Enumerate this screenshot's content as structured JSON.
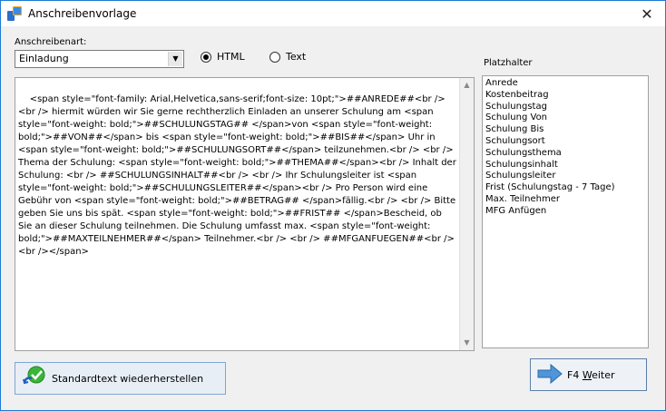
{
  "window": {
    "title": "Anschreibenvorlage"
  },
  "form": {
    "type_label": "Anschreibenart:",
    "type_selected": "Einladung",
    "radio_html_label": "HTML",
    "radio_text_label": "Text",
    "format_selected": "HTML",
    "template_text": "<span style=\"font-family: Arial,Helvetica,sans-serif;font-size: 10pt;\">##ANREDE##<br />\n<br /> hiermit würden wir Sie gerne rechtherzlich Einladen an unserer Schulung am <span style=\"font-weight: bold;\">##SCHULUNGSTAG## </span>von <span style=\"font-weight: bold;\">##VON##</span> bis <span style=\"font-weight: bold;\">##BIS##</span> Uhr in <span style=\"font-weight: bold;\">##SCHULUNGSORT##</span> teilzunehmen.<br /> <br /> Thema der Schulung: <span style=\"font-weight: bold;\">##THEMA##</span><br /> Inhalt der Schulung: <br /> ##SCHULUNGSINHALT##<br /> <br /> Ihr Schulungsleiter ist <span style=\"font-weight: bold;\">##SCHULUNGSLEITER##</span><br /> Pro Person wird eine Gebühr von <span style=\"font-weight: bold;\">##BETRAG## </span>fällig.<br /> <br /> Bitte geben Sie uns bis spät. <span style=\"font-weight: bold;\">##FRIST## </span>Bescheid, ob Sie an dieser Schulung teilnehmen. Die Schulung umfasst max. <span style=\"font-weight: bold;\">##MAXTEILNEHMER##</span> Teilnehmer.<br /> <br /> ##MFGANFUEGEN##<br /> <br /></span>"
  },
  "placeholders": {
    "label": "Platzhalter",
    "items": [
      "Anrede",
      "Kostenbeitrag",
      "Schulungstag",
      "Schulung Von",
      "Schulung Bis",
      "Schulungsort",
      "Schulungsthema",
      "Schulungsinhalt",
      "Schulungsleiter",
      "Frist (Schulungstag - 7 Tage)",
      "Max. Teilnehmer",
      "MFG Anfügen"
    ]
  },
  "buttons": {
    "restore_label": "Standardtext wiederherstellen",
    "next_prefix": "F4 ",
    "next_underlined": "W",
    "next_rest": "eiter"
  },
  "colors": {
    "accent": "#1c7ad6",
    "button_border": "#7fa7d4"
  },
  "icons": {
    "app": "app-icon",
    "close": "close-icon",
    "restore": "checkmark-undo-icon",
    "next": "arrow-right-icon"
  }
}
